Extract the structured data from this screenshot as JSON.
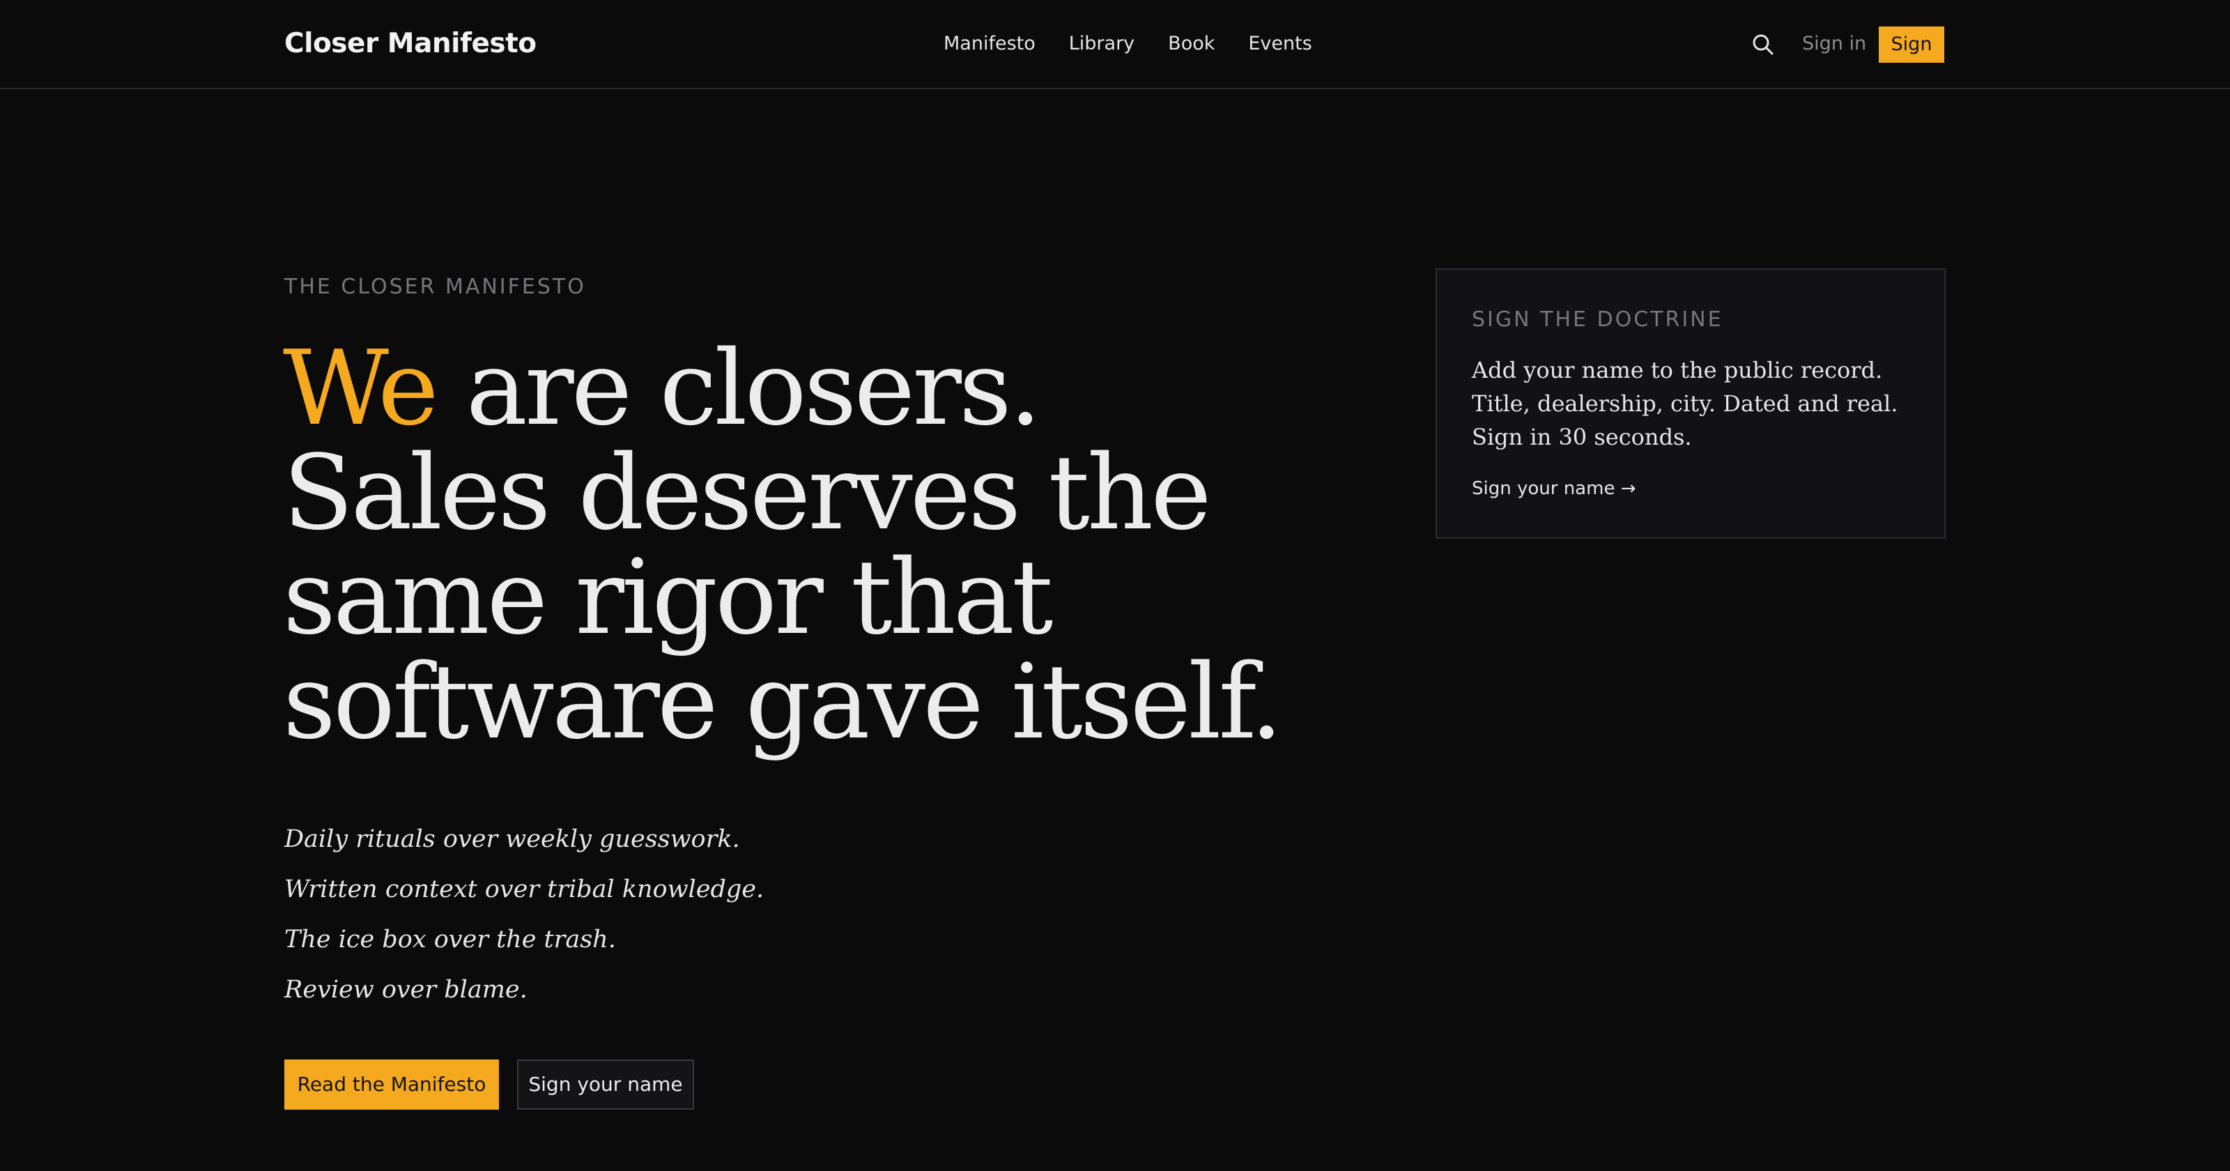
{
  "header": {
    "brand": "Closer Manifesto",
    "nav": [
      "Manifesto",
      "Library",
      "Book",
      "Events"
    ],
    "search_icon": "search-icon",
    "signin_label": "Sign in",
    "sign_label": "Sign"
  },
  "hero": {
    "eyebrow": "THE CLOSER MANIFESTO",
    "headline_accent": "We",
    "headline_line1_rest": " are closers.",
    "headline_line2": "Sales deserves the",
    "headline_line3": "same rigor that",
    "headline_line4": "software gave itself.",
    "principles": [
      "Daily rituals over weekly guesswork.",
      "Written context over tribal knowledge.",
      "The ice box over the trash.",
      "Review over blame."
    ],
    "primary_cta": "Read the Manifesto",
    "secondary_cta": "Sign your name"
  },
  "card": {
    "eyebrow": "SIGN THE DOCTRINE",
    "body_lines": [
      "Add your name to the public record.",
      "Title, dealership, city. Dated and real.",
      "Sign in 30 seconds."
    ],
    "link_label": "Sign your name",
    "link_icon": "arrow-right-icon"
  },
  "colors": {
    "background": "#0b0b0c",
    "accent": "#f5a91f",
    "card_background": "#121214",
    "muted_text": "#77777a"
  }
}
